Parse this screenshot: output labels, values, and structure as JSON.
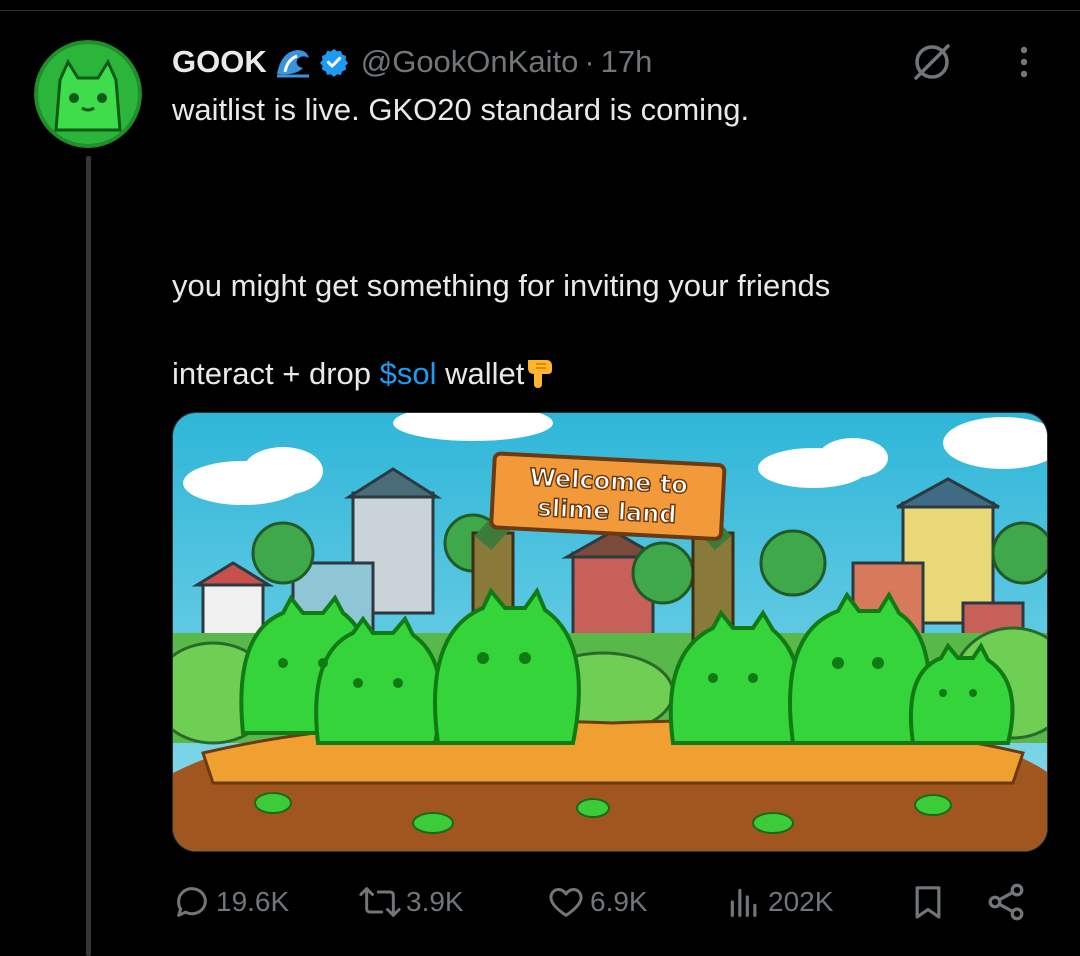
{
  "tweet": {
    "author_name": "GOOK",
    "handle": "@GookOnKaito",
    "separator": "·",
    "time": "17h",
    "lines": [
      "waitlist is live. GKO20 standard is coming.",
      "you might get something for inviting your friends"
    ],
    "line3_prefix": "interact + drop ",
    "cashtag": "$sol",
    "line3_suffix": " wallet"
  },
  "media": {
    "sign_line1": "Welcome to",
    "sign_line2": "slime land"
  },
  "actions": {
    "replies": "19.6K",
    "retweets": "3.9K",
    "likes": "6.9K",
    "views": "202K"
  },
  "icons": {
    "wave": "water-wave-emoji",
    "verified": "verified-badge-icon",
    "grok": "grok-icon",
    "more": "more-dots-icon",
    "point": "backhand-index-pointing-down-emoji",
    "reply": "reply-icon",
    "retweet": "retweet-icon",
    "like": "heart-icon",
    "views": "views-icon",
    "bookmark": "bookmark-icon",
    "share": "share-icon"
  },
  "colors": {
    "background": "#000000",
    "text": "#e7e9ea",
    "secondary": "#71767b",
    "link": "#1d9bf0",
    "verified": "#1d9bf0"
  }
}
